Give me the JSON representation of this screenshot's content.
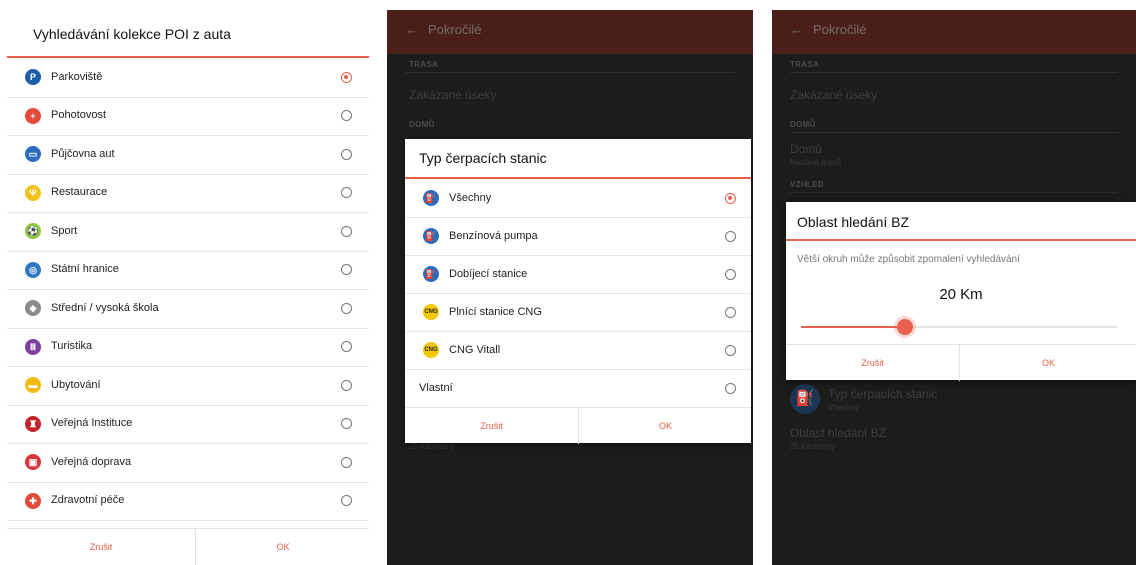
{
  "screen1": {
    "dialog_title": "Vyhledávání kolekce POI z auta",
    "items": [
      {
        "label": "Parkoviště",
        "icon": "parking-icon",
        "glyph": "P",
        "color": "#1b5ea8",
        "selected": true
      },
      {
        "label": "Pohotovost",
        "icon": "ambulance-icon",
        "glyph": "+",
        "color": "#e24a3b",
        "selected": false
      },
      {
        "label": "Půjčovna aut",
        "icon": "car-rental-icon",
        "glyph": "▭",
        "color": "#2a6cc0",
        "selected": false
      },
      {
        "label": "Restaurace",
        "icon": "restaurant-icon",
        "glyph": "Ψ",
        "color": "#f1c21b",
        "selected": false
      },
      {
        "label": "Sport",
        "icon": "sport-icon",
        "glyph": "⚽",
        "color": "#8cc63f",
        "selected": false
      },
      {
        "label": "Státní hranice",
        "icon": "border-icon",
        "glyph": "◎",
        "color": "#2f78c4",
        "selected": false
      },
      {
        "label": "Střední / vysoká škola",
        "icon": "school-icon",
        "glyph": "◆",
        "color": "#8a8a8a",
        "selected": false
      },
      {
        "label": "Turistika",
        "icon": "tourism-icon",
        "glyph": "Ⅲ",
        "color": "#7b3fa0",
        "selected": false
      },
      {
        "label": "Ubytování",
        "icon": "accommodation-icon",
        "glyph": "▬",
        "color": "#f2b90f",
        "selected": false
      },
      {
        "label": "Veřejná Instituce",
        "icon": "institution-icon",
        "glyph": "♜",
        "color": "#c4252b",
        "selected": false
      },
      {
        "label": "Veřejná doprava",
        "icon": "public-transport-icon",
        "glyph": "▣",
        "color": "#d8363a",
        "selected": false
      },
      {
        "label": "Zdravotní péče",
        "icon": "healthcare-icon",
        "glyph": "✚",
        "color": "#e44a3a",
        "selected": false
      }
    ],
    "cancel": "Zrušit",
    "ok": "OK"
  },
  "screen2": {
    "topbar_title": "Pokročilé",
    "section_trasa": "TRASA",
    "row_zakazane": "Zakázané úseky",
    "section_domu": "DOMŮ",
    "below_dialog": "25 Kilometry",
    "dialog_title": "Typ čerpacích stanic",
    "items": [
      {
        "label": "Všechny",
        "icon": "fuel-pump-icon",
        "glyph": "⛽",
        "color": "#2a6cc0",
        "selected": true
      },
      {
        "label": "Benzínová pumpa",
        "icon": "fuel-pump-icon",
        "glyph": "⛽",
        "color": "#2a6cc0",
        "selected": false
      },
      {
        "label": "Dobíjecí stanice",
        "icon": "charging-station-icon",
        "glyph": "⛽",
        "color": "#2a6cc0",
        "selected": false
      },
      {
        "label": "Plnící stanice CNG",
        "icon": "cng-icon",
        "glyph": "CNG",
        "color": "#f5c800",
        "selected": false
      },
      {
        "label": "CNG Vitall",
        "icon": "cng-icon",
        "glyph": "CNG",
        "color": "#f5c800",
        "selected": false
      },
      {
        "label": "Vlastní",
        "icon": "",
        "glyph": "",
        "color": "",
        "selected": false
      }
    ],
    "cancel": "Zrušit",
    "ok": "OK"
  },
  "screen3": {
    "topbar_title": "Pokročilé",
    "section_trasa": "TRASA",
    "row_zakazane": "Zakázané úseky",
    "section_domu": "DOMŮ",
    "row_domu": "Domů",
    "row_domu_sub": "Nastavit domů",
    "section_vzhled": "VZHLED",
    "row_typ": "Typ čerpacích stanic",
    "row_typ_sub": "Všechny",
    "row_oblast": "Oblast hledání BZ",
    "row_oblast_sub": "25 Kilometry",
    "dialog_title": "Oblast hledání BZ",
    "dialog_desc": "Větší okruh může způsobit zpomalení vyhledávání",
    "value_label": "20 Km",
    "slider_fraction": 0.33,
    "cancel": "Zrušit",
    "ok": "OK"
  },
  "colors": {
    "accent": "#e8604f",
    "topbar": "#8c2d21"
  }
}
